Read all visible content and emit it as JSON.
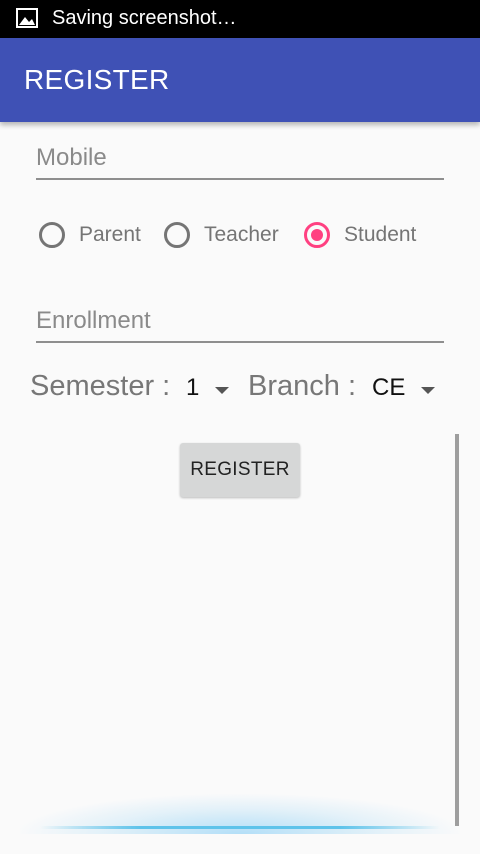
{
  "status_bar": {
    "notification_icon": "image-icon",
    "text": "Saving screenshot…"
  },
  "app_bar": {
    "title": "REGISTER",
    "color": "#3f51b5"
  },
  "form": {
    "mobile": {
      "value": "",
      "placeholder": "Mobile"
    },
    "role": {
      "options": [
        "Parent",
        "Teacher",
        "Student"
      ],
      "selected": "Student",
      "accent_color": "#ff4081"
    },
    "enrollment": {
      "value": "",
      "placeholder": "Enrollment"
    },
    "semester": {
      "label": "Semester :",
      "value": "1"
    },
    "branch": {
      "label": "Branch :",
      "value": "CE"
    },
    "register_button": "REGISTER"
  }
}
